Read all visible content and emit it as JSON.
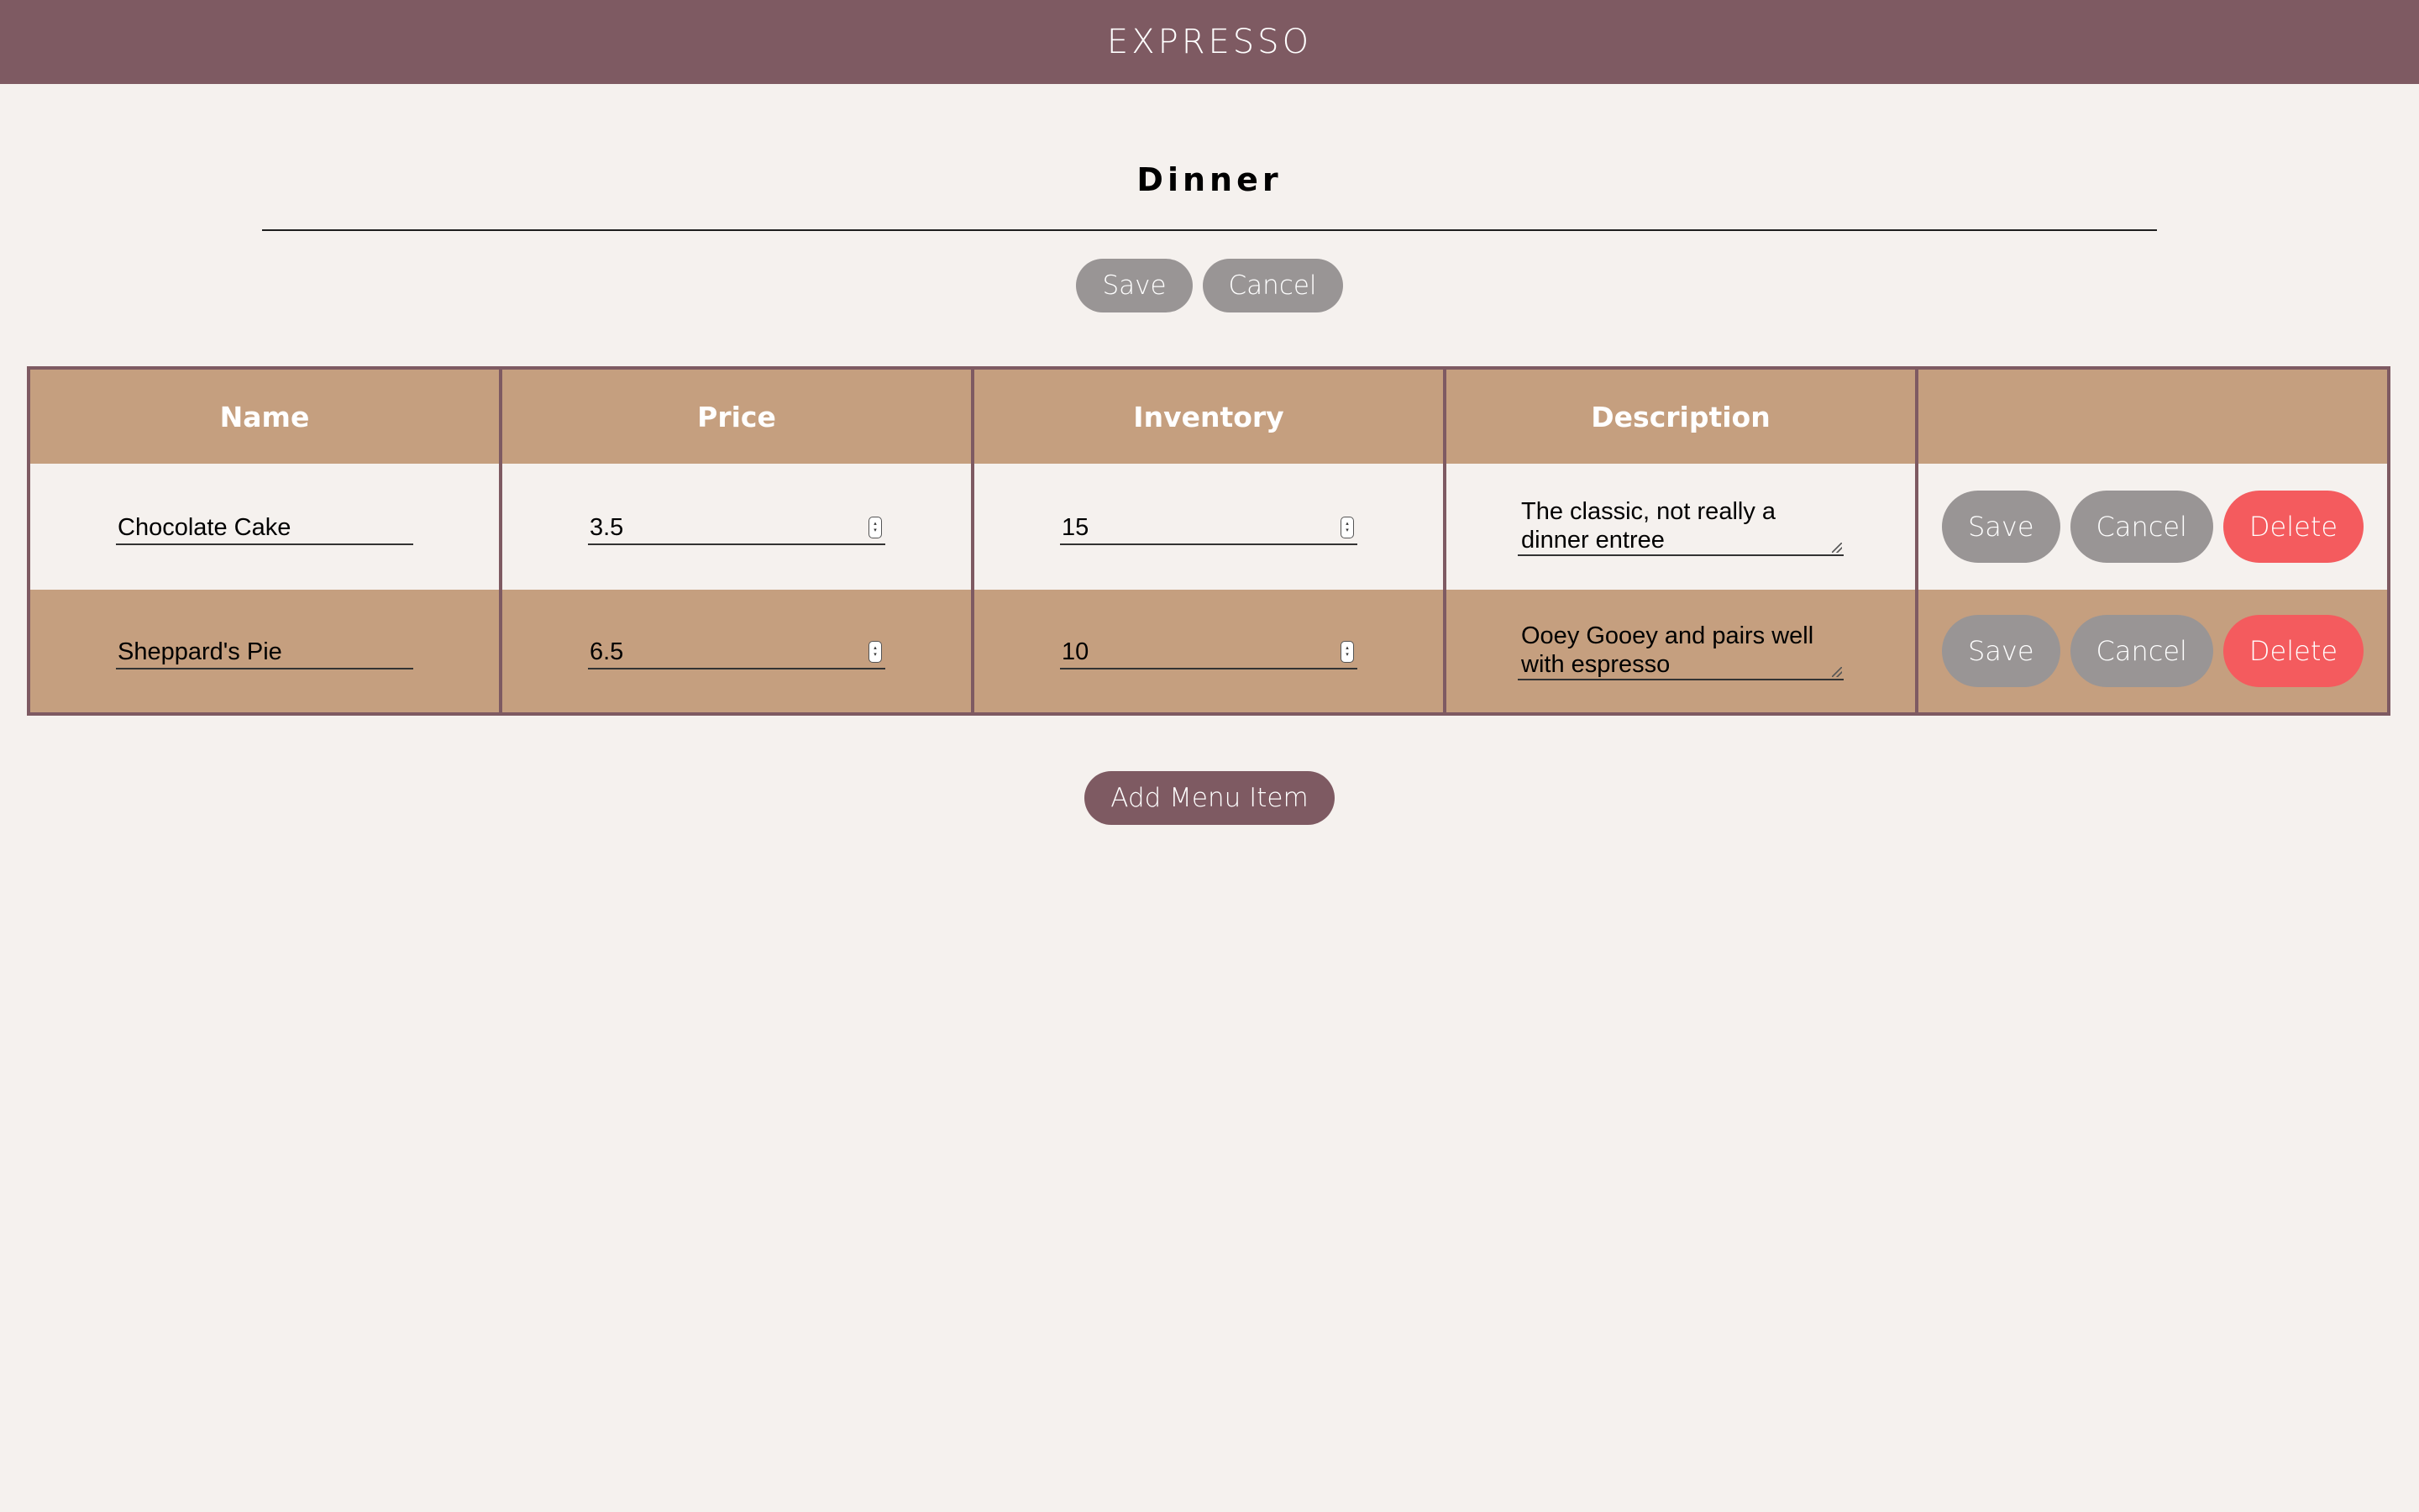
{
  "app": {
    "brand": "EXPRESSO"
  },
  "menu": {
    "title": "Dinner",
    "save_label": "Save",
    "cancel_label": "Cancel"
  },
  "table": {
    "columns": [
      "Name",
      "Price",
      "Inventory",
      "Description",
      ""
    ],
    "rows": [
      {
        "name": "Chocolate Cake",
        "price": "3.5",
        "inventory": "15",
        "description": "The classic, not really a dinner entree",
        "save_label": "Save",
        "cancel_label": "Cancel",
        "delete_label": "Delete"
      },
      {
        "name": "Sheppard's Pie",
        "price": "6.5",
        "inventory": "10",
        "description": "Ooey Gooey and pairs well with espresso",
        "save_label": "Save",
        "cancel_label": "Cancel",
        "delete_label": "Delete"
      }
    ]
  },
  "footer": {
    "add_label": "Add Menu Item"
  },
  "colors": {
    "header_bar": "#7e5a62",
    "table_tan": "#c59f7f",
    "background": "#f5f1ee",
    "neutral_button": "#999595",
    "delete_button": "#f45b5e"
  }
}
